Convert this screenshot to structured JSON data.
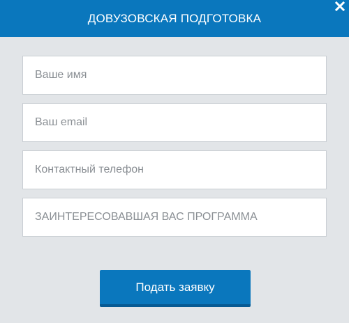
{
  "header": {
    "title": "ДОВУЗОВСКАЯ ПОДГОТОВКА"
  },
  "form": {
    "name_placeholder": "Ваше имя",
    "email_placeholder": "Ваш email",
    "phone_placeholder": "Контактный телефон",
    "program_placeholder": "ЗАИНТЕРЕСОВАВШАЯ ВАС ПРОГРАММА",
    "submit_label": "Подать заявку"
  },
  "icons": {
    "close": "close-icon"
  },
  "colors": {
    "accent": "#0a77bd",
    "background": "#e2e5e8"
  }
}
